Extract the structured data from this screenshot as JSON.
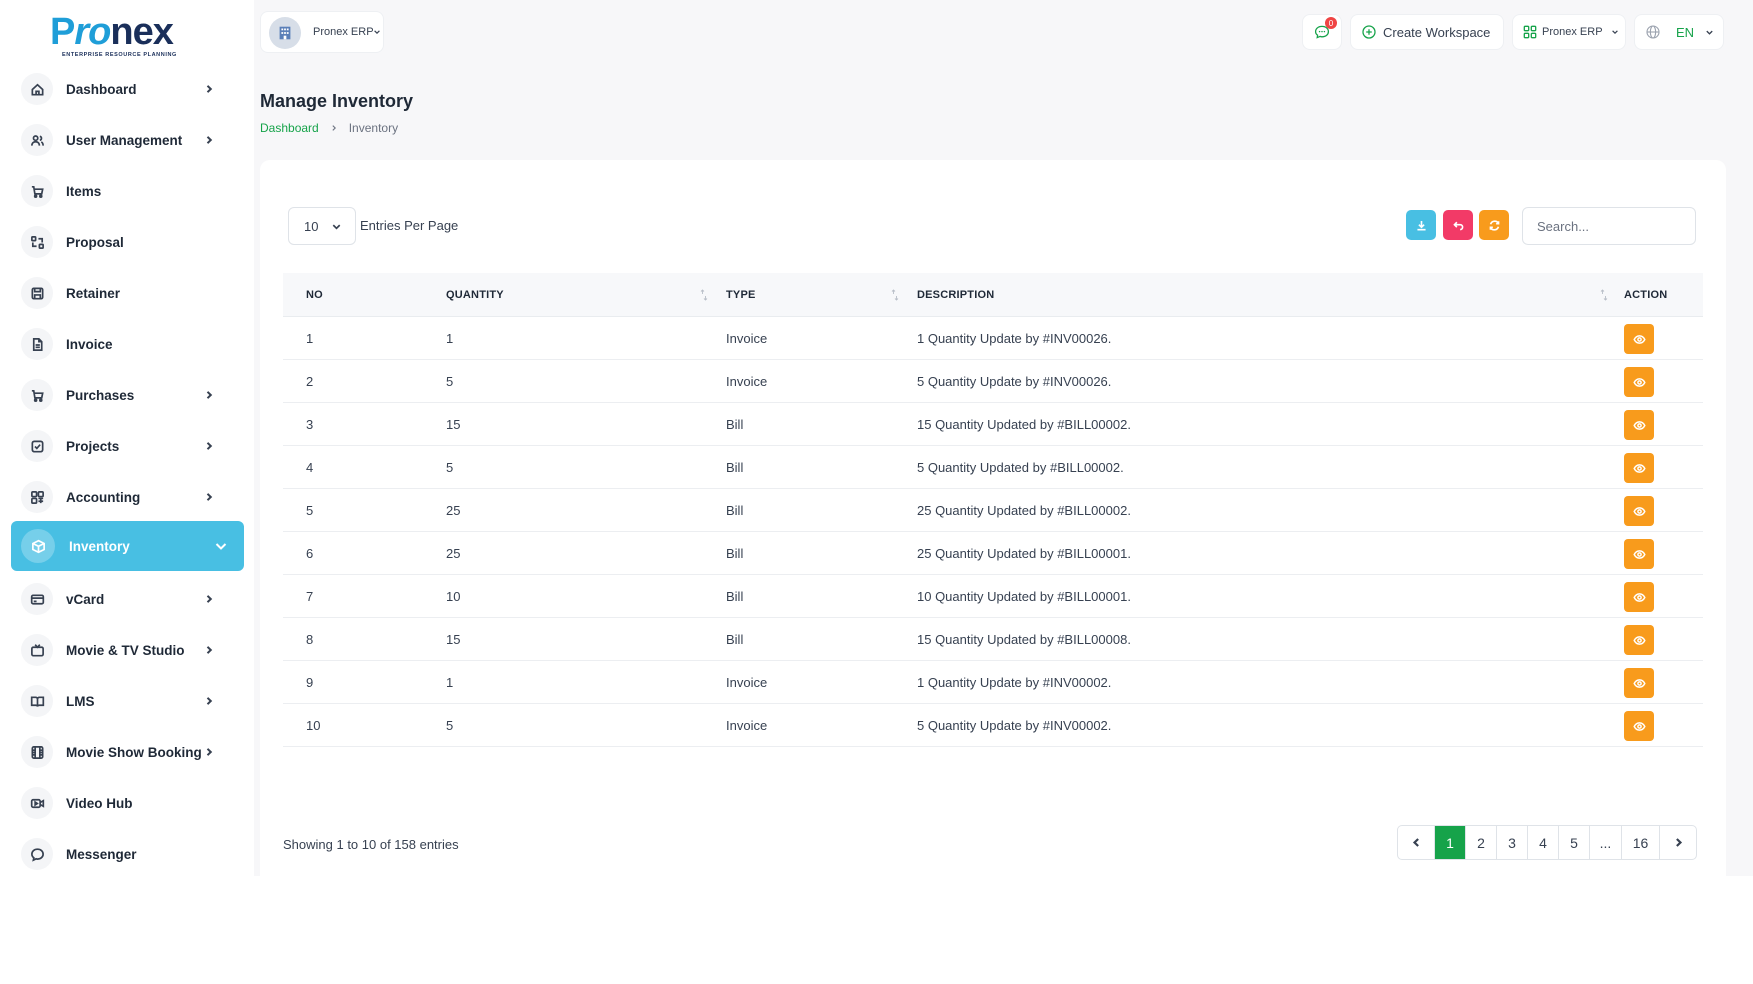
{
  "brand": {
    "logo_text_p": "P",
    "logo_text_ro": "ro",
    "logo_text_nex": "nex",
    "tagline": "ENTERPRISE RESOURCE PLANNING",
    "primary_color": "#16a34a",
    "sidebar_active_color": "#48bfe3",
    "action_color": "#f89b1c"
  },
  "sidebar": {
    "items": [
      {
        "label": "Dashboard",
        "icon": "home-icon",
        "has_submenu": true,
        "active": false
      },
      {
        "label": "User Management",
        "icon": "users-icon",
        "has_submenu": true,
        "active": false
      },
      {
        "label": "Items",
        "icon": "cart-icon",
        "has_submenu": false,
        "active": false
      },
      {
        "label": "Proposal",
        "icon": "arrows-icon",
        "has_submenu": false,
        "active": false
      },
      {
        "label": "Retainer",
        "icon": "save-icon",
        "has_submenu": false,
        "active": false
      },
      {
        "label": "Invoice",
        "icon": "file-icon",
        "has_submenu": false,
        "active": false
      },
      {
        "label": "Purchases",
        "icon": "cart-icon",
        "has_submenu": true,
        "active": false
      },
      {
        "label": "Projects",
        "icon": "check-square-icon",
        "has_submenu": true,
        "active": false
      },
      {
        "label": "Accounting",
        "icon": "grid-icon",
        "has_submenu": true,
        "active": false
      },
      {
        "label": "Inventory",
        "icon": "box-icon",
        "has_submenu": true,
        "active": true
      },
      {
        "label": "vCard",
        "icon": "card-icon",
        "has_submenu": true,
        "active": false
      },
      {
        "label": "Movie & TV Studio",
        "icon": "tv-icon",
        "has_submenu": true,
        "active": false
      },
      {
        "label": "LMS",
        "icon": "book-icon",
        "has_submenu": true,
        "active": false
      },
      {
        "label": "Movie Show Booking",
        "icon": "film-icon",
        "has_submenu": true,
        "active": false
      },
      {
        "label": "Video Hub",
        "icon": "video-icon",
        "has_submenu": false,
        "active": false
      },
      {
        "label": "Messenger",
        "icon": "message-icon",
        "has_submenu": false,
        "active": false
      }
    ]
  },
  "header": {
    "workspace_label": "Pronex ERP",
    "message_count": "0",
    "create_workspace_label": "Create Workspace",
    "erp_label": "Pronex ERP",
    "language": "EN"
  },
  "page": {
    "title": "Manage Inventory",
    "breadcrumb": [
      "Dashboard",
      "Inventory"
    ]
  },
  "table_controls": {
    "entries_per_page": "10",
    "entries_per_page_label": "Entries Per Page",
    "search_placeholder": "Search..."
  },
  "table": {
    "columns": [
      "NO",
      "QUANTITY",
      "TYPE",
      "DESCRIPTION",
      "ACTION"
    ],
    "rows": [
      {
        "no": "1",
        "quantity": "1",
        "type": "Invoice",
        "description": "1 Quantity Update by #INV00026."
      },
      {
        "no": "2",
        "quantity": "5",
        "type": "Invoice",
        "description": "5 Quantity Update by #INV00026."
      },
      {
        "no": "3",
        "quantity": "15",
        "type": "Bill",
        "description": "15 Quantity Updated by #BILL00002."
      },
      {
        "no": "4",
        "quantity": "5",
        "type": "Bill",
        "description": "5 Quantity Updated by #BILL00002."
      },
      {
        "no": "5",
        "quantity": "25",
        "type": "Bill",
        "description": "25 Quantity Updated by #BILL00002."
      },
      {
        "no": "6",
        "quantity": "25",
        "type": "Bill",
        "description": "25 Quantity Updated by #BILL00001."
      },
      {
        "no": "7",
        "quantity": "10",
        "type": "Bill",
        "description": "10 Quantity Updated by #BILL00001."
      },
      {
        "no": "8",
        "quantity": "15",
        "type": "Bill",
        "description": "15 Quantity Updated by #BILL00008."
      },
      {
        "no": "9",
        "quantity": "1",
        "type": "Invoice",
        "description": "1 Quantity Update by #INV00002."
      },
      {
        "no": "10",
        "quantity": "5",
        "type": "Invoice",
        "description": "5 Quantity Update by #INV00002."
      }
    ]
  },
  "footer": {
    "showing": "Showing 1 to 10 of 158 entries",
    "pages": [
      "1",
      "2",
      "3",
      "4",
      "5",
      "...",
      "16"
    ],
    "current_page": "1"
  }
}
